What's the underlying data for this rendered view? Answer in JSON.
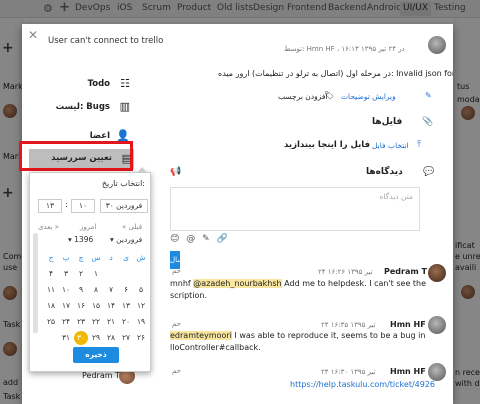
{
  "topbar": {
    "tabs": [
      {
        "label": "DevOps",
        "active": false
      },
      {
        "label": "iOS",
        "active": false
      },
      {
        "label": "Scrum",
        "active": false
      },
      {
        "label": "Product",
        "active": false
      },
      {
        "label": "Old lists",
        "active": false
      },
      {
        "label": "Design",
        "active": false
      },
      {
        "label": "Frontend",
        "active": false
      },
      {
        "label": "Backend",
        "active": false
      },
      {
        "label": "Android",
        "active": false
      },
      {
        "label": "UI/UX",
        "active": true
      },
      {
        "label": "Testing",
        "active": false
      }
    ]
  },
  "background": {
    "left_texts": [
      "Mark",
      "Mark",
      "Com",
      "use",
      "Task",
      "add",
      "Task"
    ],
    "right_texts": [
      "tus",
      "modal",
      "ificat",
      "e unre",
      "availi",
      "n rece",
      "with d"
    ]
  },
  "modal": {
    "title": "User can't connect to trello",
    "actions": [
      {
        "label": "Todo",
        "icon": "list-icon"
      },
      {
        "label": "لیست: Bugs",
        "icon": "board-icon"
      },
      {
        "label": "اعضا",
        "icon": "user-icon"
      },
      {
        "label": "تعیین سررسید",
        "icon": "calendar-icon"
      }
    ],
    "author_meta": "توسط: Hmn HF ، در ۲۴ تیر ۱۳۹۵ ۱۶:۱۳",
    "description": "در مرحله اول (اتصال به ترلو در تنظیمات) ارور میده: Invalid json format",
    "edit_description": "ویرایش توضیحات",
    "add_label": "افزودن برچسب",
    "files_title": "فایل‌ها",
    "choose_file": "انتخاب فایل",
    "drop_text": "فایل را اینجا بیندازید",
    "comments_title": "دیدگاه‌ها",
    "comment_placeholder": "متن دیدگاه",
    "comment_tools": "😊 @ ✎ 🔗",
    "send_label": "ارسال",
    "comments": [
      {
        "author": "Pedram T",
        "meta": "۲۴ تیر ۱۳۹۵ ۱۶:۲۶",
        "text_line1_pre": "mnhf ",
        "mention": "@azadeh_nourbakhsh",
        "text_line1_post": " Add me to helpdesk. I can't see the",
        "text_line2": "scription."
      },
      {
        "author": "Hmn HF",
        "meta": "۲۴ تیر ۱۳۹۵ ۱۶:۳۵",
        "mention": "edramteymoori",
        "text_line1_post": " I was able to reproduce it, seems to be a bug in",
        "text_line2": "lloController#callback."
      },
      {
        "author": "Hmn HF",
        "meta": "۲۴ تیر ۱۳۹۵ ۱۶:۳۰",
        "link": "https://help.taskulu.com/ticket/4926"
      }
    ],
    "other_author_fragment": "Pedram T",
    "cut_names": [
      "حم",
      "حم",
      "حم"
    ]
  },
  "datepicker": {
    "label": "انتخاب تاریخ:",
    "hour": "۱۳",
    "minute": "۱۰",
    "date": "فروردین ۳۰",
    "next": "بعدی »",
    "today": "امروز",
    "prev": "« قبلی",
    "year": "1396",
    "month": "فروردین",
    "weekdays": [
      "ش",
      "ی",
      "د",
      "س",
      "چ",
      "پ",
      "ج"
    ],
    "weeks": [
      [
        "",
        "",
        "",
        "",
        "",
        "",
        ""
      ],
      [
        "۵",
        "۶",
        "۷",
        "۸",
        "۹",
        "۱۰",
        "۱۱"
      ],
      [
        "۱۲",
        "۱۳",
        "۱۴",
        "۱۵",
        "۱۶",
        "۱۷",
        "۱۸"
      ],
      [
        "۱۹",
        "۲۰",
        "۲۱",
        "۲۲",
        "۲۳",
        "۲۴",
        "۲۵"
      ],
      [
        "۲۶",
        "۲۷",
        "۲۸",
        "۲۹",
        "۳۰",
        "۳۱",
        ""
      ]
    ],
    "first_row": [
      "۱",
      "۲",
      "۳",
      "۴"
    ],
    "today_day": "۳۰",
    "save_label": "ذخیره"
  }
}
